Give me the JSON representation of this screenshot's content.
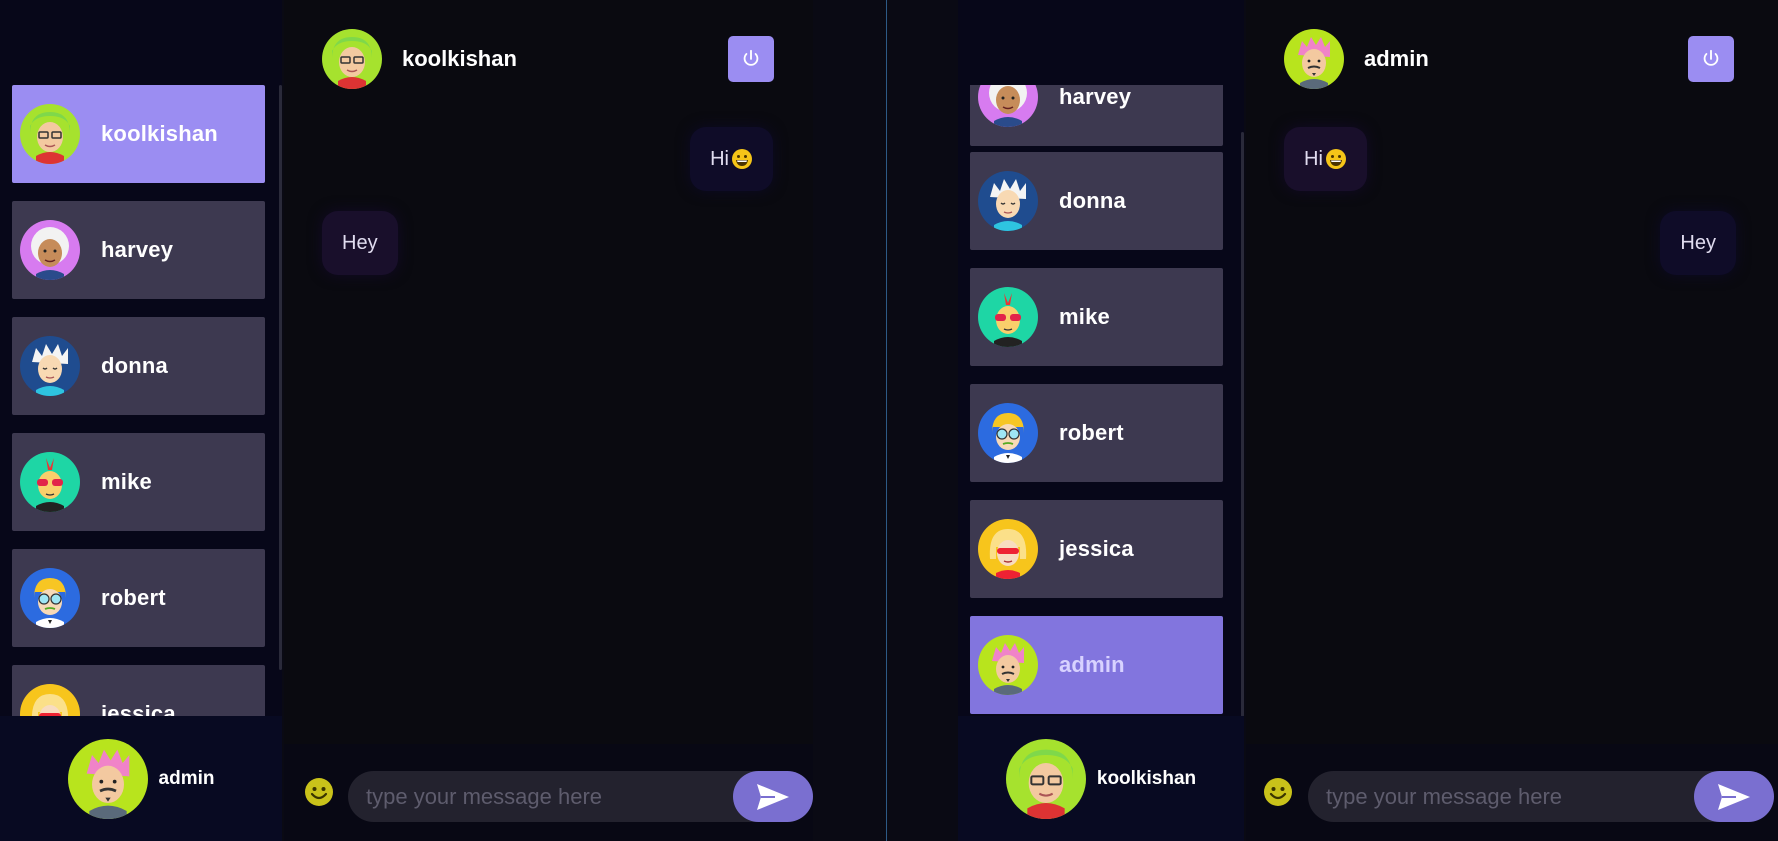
{
  "left_window": {
    "contacts": [
      {
        "name": "koolkishan",
        "selected": true
      },
      {
        "name": "harvey",
        "selected": false
      },
      {
        "name": "donna",
        "selected": false
      },
      {
        "name": "mike",
        "selected": false
      },
      {
        "name": "robert",
        "selected": false
      },
      {
        "name": "jessica",
        "selected": false
      }
    ],
    "current_user": "admin",
    "chat_title": "koolkishan",
    "messages": [
      {
        "text": "Hi",
        "type": "sent",
        "emoji": "grinning-face"
      },
      {
        "text": "Hey",
        "type": "received"
      }
    ],
    "input_placeholder": "type your message here"
  },
  "right_window": {
    "contacts": [
      {
        "name": "harvey",
        "selected": false
      },
      {
        "name": "donna",
        "selected": false
      },
      {
        "name": "mike",
        "selected": false
      },
      {
        "name": "robert",
        "selected": false
      },
      {
        "name": "jessica",
        "selected": false
      },
      {
        "name": "admin",
        "selected": true
      }
    ],
    "current_user": "koolkishan",
    "chat_title": "admin",
    "messages": [
      {
        "text": "Hi",
        "type": "received",
        "emoji": "grinning-face"
      },
      {
        "text": "Hey",
        "type": "sent"
      }
    ],
    "input_placeholder": "type your message here"
  },
  "icons": {
    "logout": "power-icon",
    "emoji": "smiley-icon",
    "send": "send-icon"
  },
  "colors": {
    "accent": "#9b8df2",
    "contact_bg": "#3d3950",
    "send_button": "#7a6fd0"
  }
}
